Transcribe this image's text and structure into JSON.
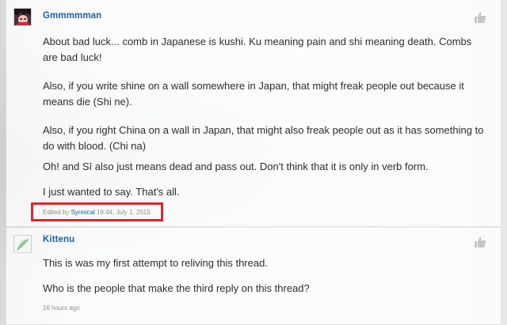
{
  "colors": {
    "link": "#1b5fa8",
    "body_text": "#2d2d2d",
    "meta_text": "#8a8f8f",
    "highlight": "#e2242a"
  },
  "posts": [
    {
      "username": "Gmmmmman",
      "avatar_icon": "anime-character-avatar",
      "like_icon": "thumbs-up-icon",
      "paragraphs": [
        "About bad luck... comb in Japanese is kushi. Ku meaning pain and shi meaning death. Combs are bad luck!",
        "Also, if you write shine on a wall somewhere in Japan, that might freak people out because it means die (Shi ne).",
        "Also, if you right China on a wall in Japan, that might also freak people out as it has something to do with blood. (Chi na)",
        "Oh! and Sī also just means dead and pass out. Don't think that it is only in verb form.",
        "I just wanted to say. That's all."
      ],
      "edited": {
        "prefix": "Edited by",
        "editor": "Synnical",
        "time": "19:44, July 1, 2015"
      }
    },
    {
      "username": "Kittenu",
      "avatar_icon": "placeholder-avatar",
      "like_icon": "thumbs-up-icon",
      "paragraphs": [
        "This is was my first attempt to reliving this thread.",
        "Who is the people that make the third reply on this thread?"
      ],
      "timestamp": "16 hours ago"
    }
  ]
}
